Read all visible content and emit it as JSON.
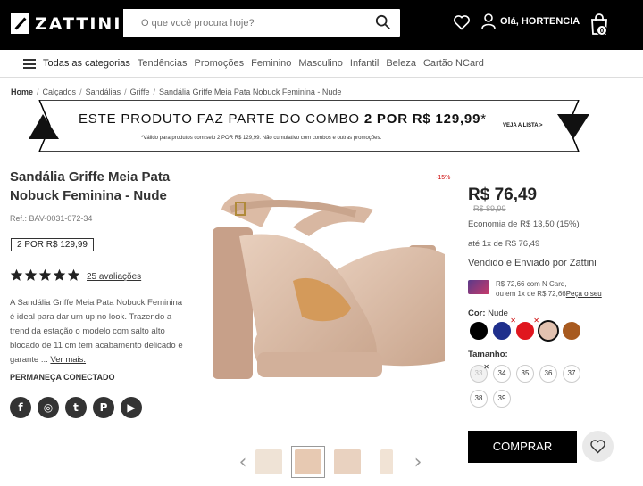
{
  "header": {
    "logo": "ZATTINI",
    "search_placeholder": "O que você procura hoje?",
    "user_greeting": "Olá, HORTENCIA",
    "bag_count": "0"
  },
  "nav": {
    "all_categories": "Todas as categorias",
    "links": [
      "Tendências",
      "Promoções",
      "Feminino",
      "Masculino",
      "Infantil",
      "Beleza",
      "Cartão NCard"
    ]
  },
  "breadcrumb": [
    "Home",
    "Calçados",
    "Sandálias",
    "Griffe",
    "Sandália Griffe Meia Pata Nobuck Feminina - Nude"
  ],
  "combo": {
    "title_pre": "ESTE PRODUTO FAZ PARTE DO COMBO ",
    "title_bold": "2 POR R$ 129,99",
    "title_post": "*",
    "note": "*Válido para produtos com selo 2 POR R$ 129,99. Não cumulativo com combos e outras promoções.",
    "link": "VEJA A LISTA >"
  },
  "product": {
    "title": "Sandália Griffe Meia Pata Nobuck Feminina - Nude",
    "ref": "Ref.: BAV-0031-072-34",
    "promo_badge": "2 POR R$ 129,99",
    "rating": 5,
    "reviews": "25 avaliações",
    "description": "A Sandália Griffe Meia Pata Nobuck Feminina é ideal para dar um up no look. Trazendo a trend da estação o modelo com salto alto blocado de 11 cm tem acabamento delicado e garante ...",
    "more_link": "Ver mais.",
    "tag_line": "PERMANEÇA CONECTADO",
    "discount": "-15%"
  },
  "social": [
    "f",
    "◎",
    "t",
    "P",
    "▶"
  ],
  "pricing": {
    "price": "R$ 76,49",
    "old_price": "R$ 89,99",
    "saving": "Economia de R$ 13,50 (15%)",
    "installments": "até 1x de R$ 76,49",
    "seller": "Vendido e Enviado por Zattini",
    "card_line1": "R$ 72,66 com N Card,",
    "card_line2": "ou em 1x de R$ 72,66",
    "card_link": "Peça o seu"
  },
  "colors": {
    "label": "Cor:",
    "selected": "Nude",
    "swatches": [
      {
        "color": "#000000",
        "unavailable": false,
        "selected": false
      },
      {
        "color": "#1f2f8c",
        "unavailable": true,
        "selected": false
      },
      {
        "color": "#e0161e",
        "unavailable": true,
        "selected": false
      },
      {
        "color": "#e2c2b0",
        "unavailable": false,
        "selected": true
      },
      {
        "color": "#a85a1f",
        "unavailable": false,
        "selected": false
      }
    ]
  },
  "sizes": {
    "label": "Tamanho:",
    "options": [
      {
        "size": "33",
        "unavailable": true
      },
      {
        "size": "34",
        "unavailable": false
      },
      {
        "size": "35",
        "unavailable": false
      },
      {
        "size": "36",
        "unavailable": false
      },
      {
        "size": "37",
        "unavailable": false
      },
      {
        "size": "38",
        "unavailable": false
      },
      {
        "size": "39",
        "unavailable": false
      }
    ]
  },
  "buy_label": "COMPRAR"
}
